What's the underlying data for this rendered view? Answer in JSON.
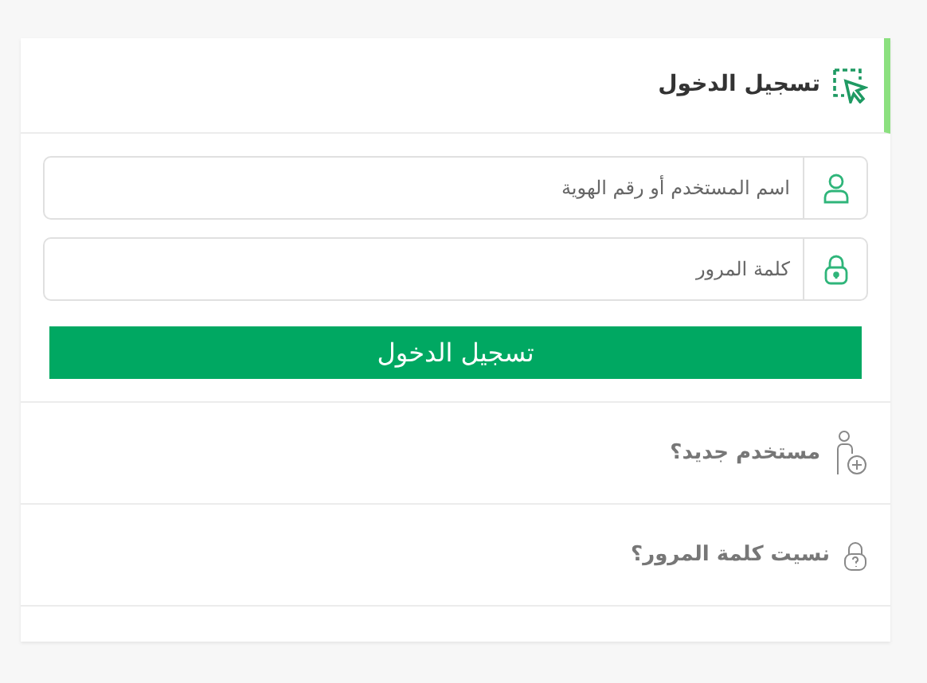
{
  "header": {
    "title": "تسجيل الدخول"
  },
  "fields": [
    {
      "kind": "user",
      "placeholder": "اسم المستخدم أو رقم الهوية"
    },
    {
      "kind": "lock",
      "placeholder": "كلمة المرور"
    }
  ],
  "submit": "تسجيل الدخول",
  "links": [
    {
      "kind": "new-user",
      "label": "مستخدم جديد؟"
    },
    {
      "kind": "forgot",
      "label": "نسيت كلمة المرور؟"
    }
  ]
}
